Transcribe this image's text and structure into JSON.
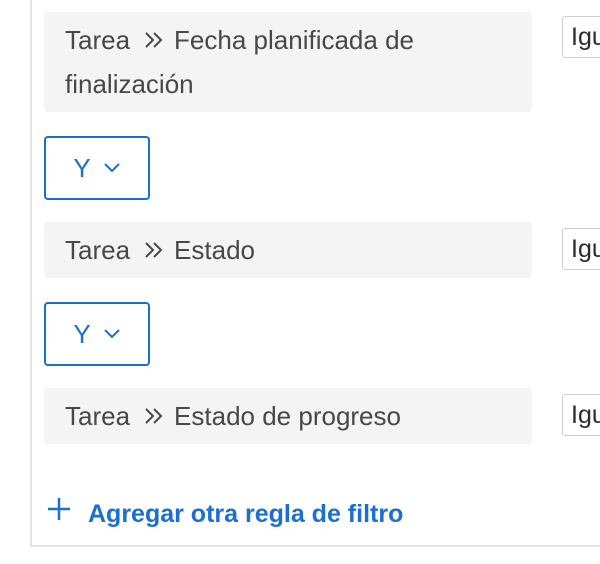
{
  "rules": [
    {
      "entity": "Tarea",
      "field_line1": "Fecha planificada de",
      "field_line2": "finalización",
      "operator": "Igual"
    },
    {
      "entity": "Tarea",
      "field": "Estado",
      "operator": "Igual"
    },
    {
      "entity": "Tarea",
      "field": "Estado de progreso",
      "operator": "Igual"
    }
  ],
  "connectors": [
    {
      "label": "Y"
    },
    {
      "label": "Y"
    }
  ],
  "add_rule_label": "Agregar otra regla de filtro",
  "colors": {
    "accent": "#1a6fd3",
    "field_bg": "#f4f4f4",
    "border": "#e3e3e3"
  },
  "icons": {
    "separator": "double-chevron-right-icon",
    "dropdown": "chevron-down-icon",
    "add": "plus-icon"
  }
}
